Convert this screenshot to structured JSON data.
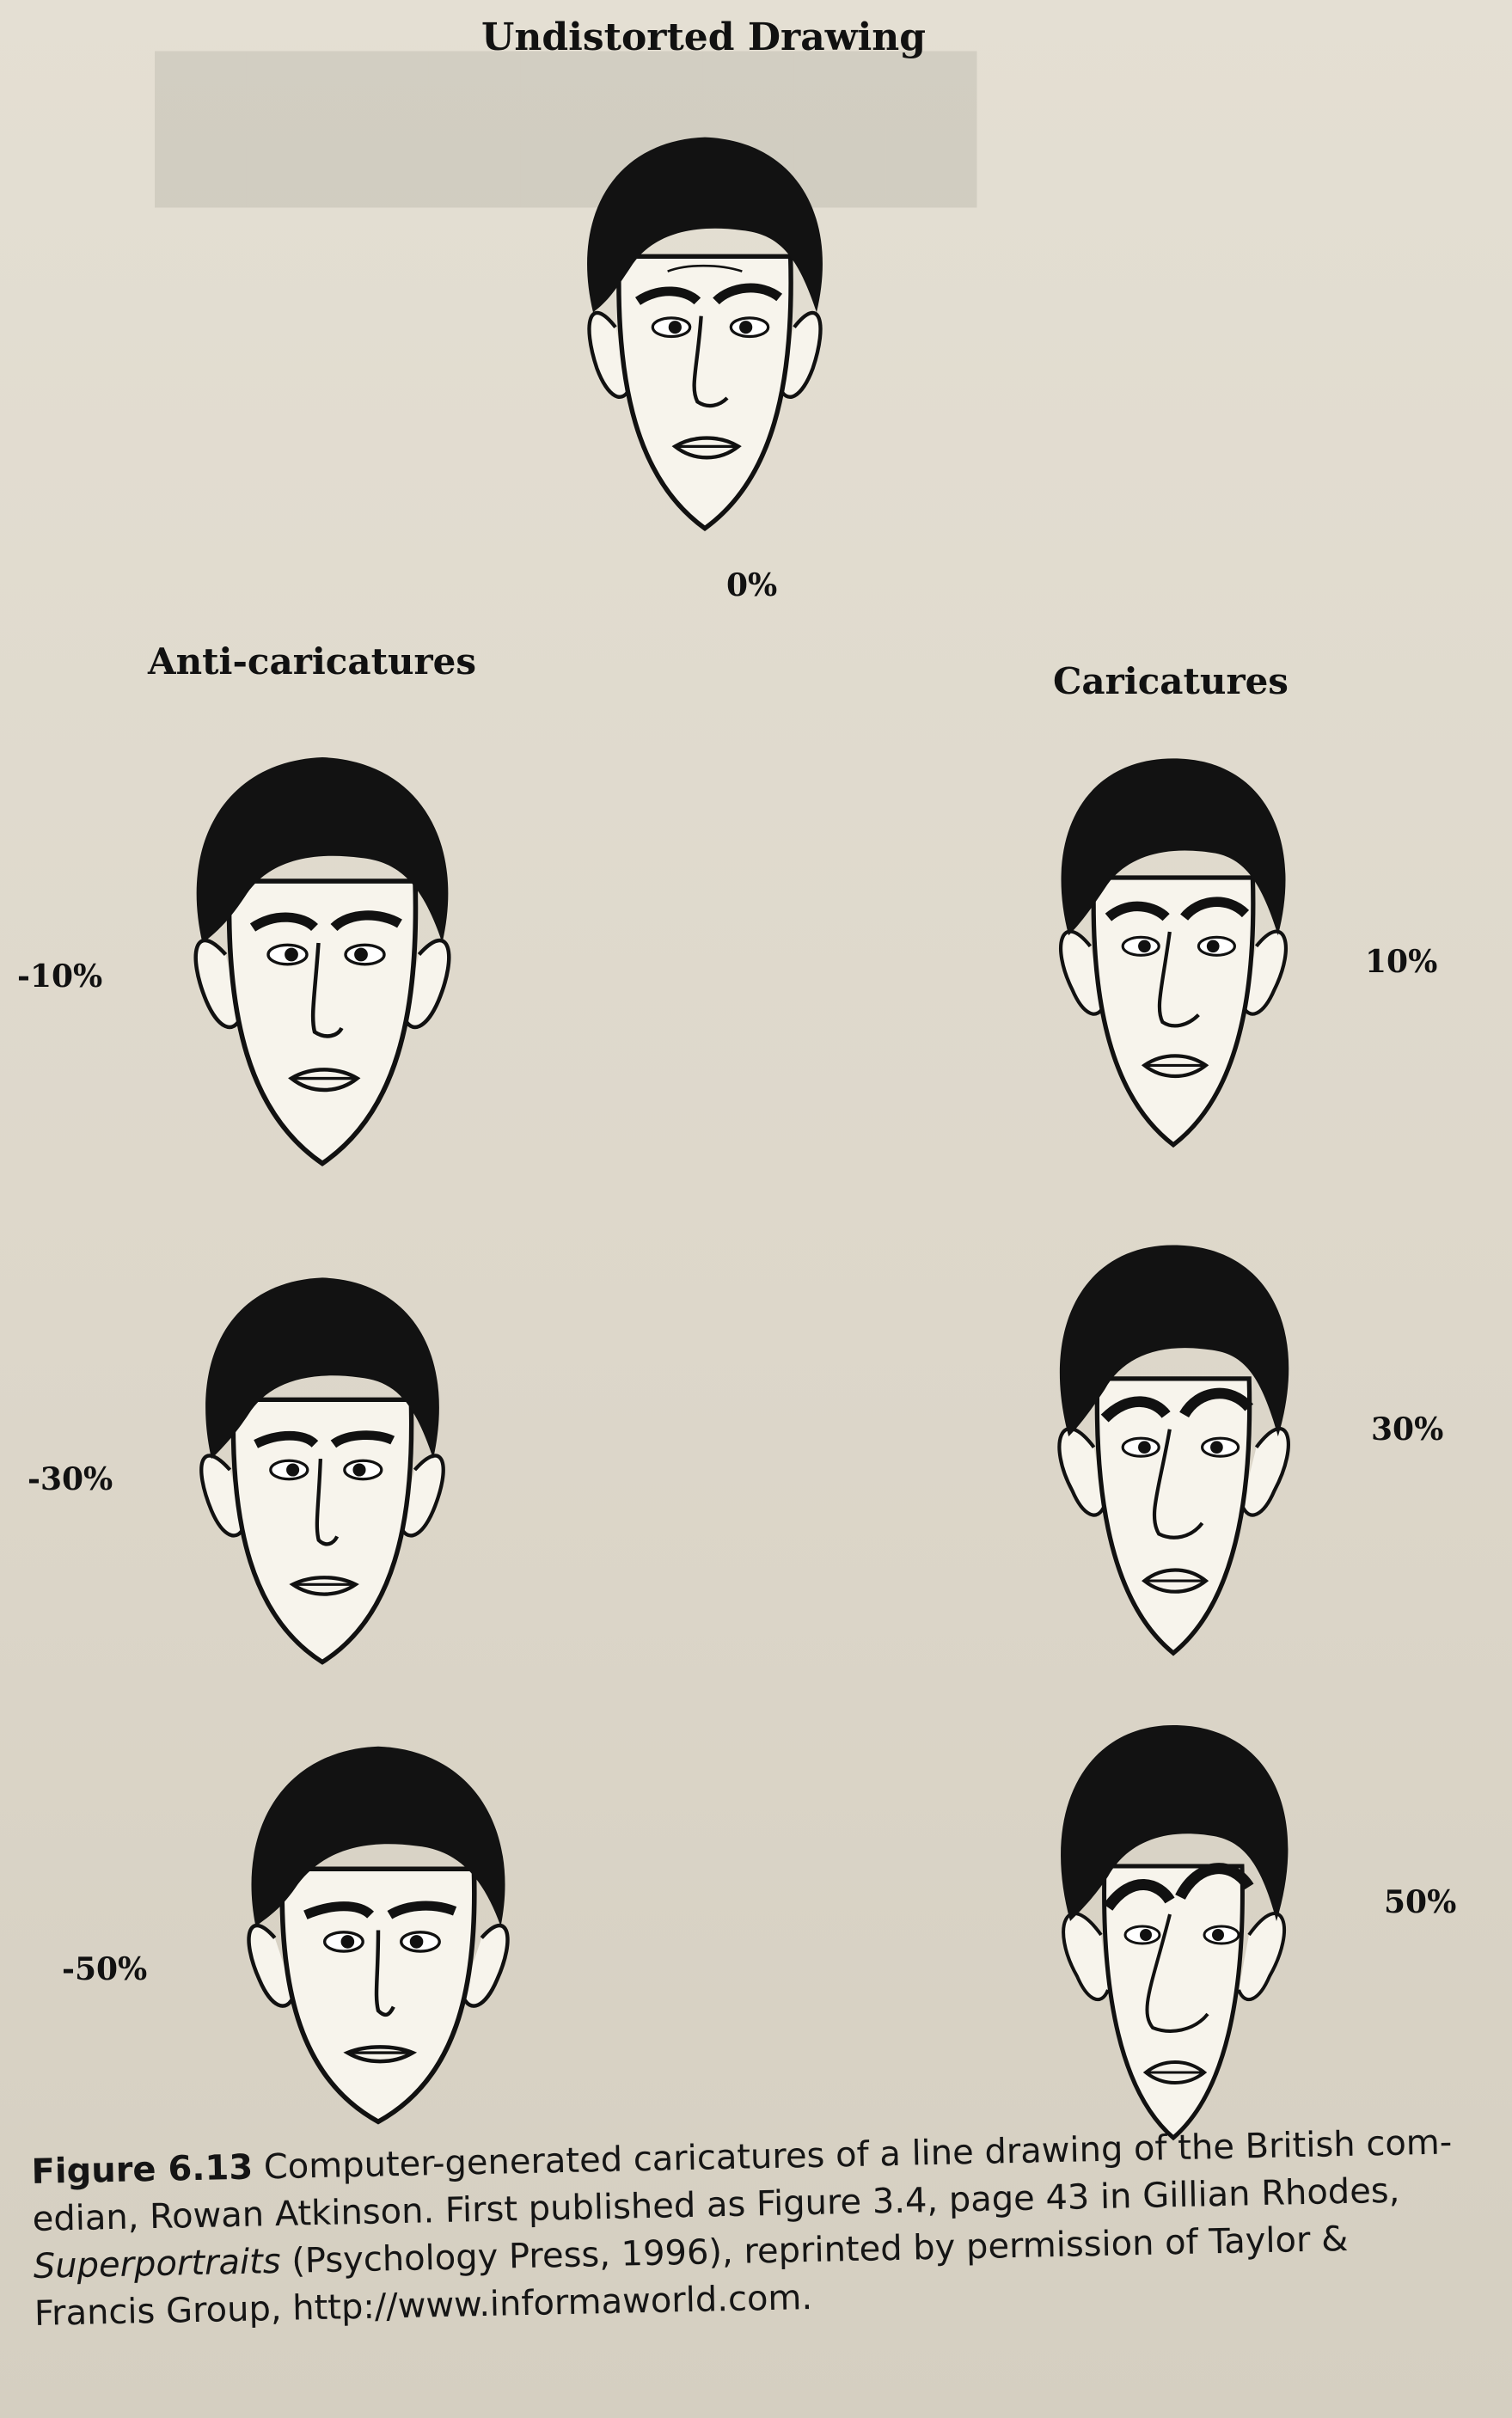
{
  "figure_title_top": "Undistorted Drawing",
  "heading_left": "Anti-caricatures",
  "heading_right": "Caricatures",
  "faces": {
    "center": {
      "percent": "0%"
    },
    "left": [
      {
        "percent": "-10%"
      },
      {
        "percent": "-30%"
      },
      {
        "percent": "-50%"
      }
    ],
    "right": [
      {
        "percent": "10%"
      },
      {
        "percent": "30%"
      },
      {
        "percent": "50%"
      }
    ]
  },
  "caption": {
    "figure_label": "Figure 6.13",
    "line1_text": "Computer-generated caricatures of a line drawing of the British com-",
    "line2_text": "edian, Rowan Atkinson. First published as Figure 3.4, page 43 in Gillian Rhodes,",
    "line3_italic": "Superportraits",
    "line3_text": "(Psychology Press, 1996), reprinted by permission of Taylor &",
    "line4_text": "Francis Group, http://www.informaworld.com."
  }
}
